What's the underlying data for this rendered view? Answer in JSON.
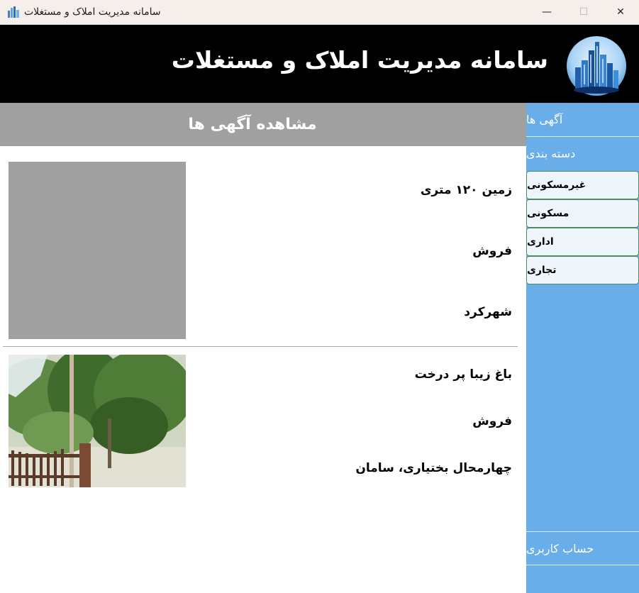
{
  "window": {
    "title": "سامانه مدیریت املاک و مستغلات",
    "minimize_glyph": "—",
    "maximize_glyph": "☐",
    "close_glyph": "✕"
  },
  "header": {
    "title": "سامانه مدیریت املاک و مستغلات",
    "logo_icon": "city-skyline-logo"
  },
  "main": {
    "view_title": "مشاهده آگهی ها",
    "listings": [
      {
        "title": "زمین ۱۲۰ متری",
        "deal_type": "فروش",
        "location": "شهرکرد",
        "image": "placeholder-gray"
      },
      {
        "title": "باغ زیبا پر درخت",
        "deal_type": "فروش",
        "location": "چهارمحال بختیاری، سامان",
        "image": "garden-photo"
      }
    ]
  },
  "sidebar": {
    "ads_label": "آگهی ها",
    "category_label": "دسته بندی",
    "categories": [
      {
        "label": "غیرمسکونی"
      },
      {
        "label": "مسکونی"
      },
      {
        "label": "اداری"
      },
      {
        "label": "تجاری"
      }
    ],
    "account_label": "حساب کاربری"
  },
  "colors": {
    "header_bg": "#000000",
    "sidebar_bg": "#6aaee9",
    "view_header_bg": "#a0a0a0",
    "titlebar_bg": "#f5eeea"
  }
}
